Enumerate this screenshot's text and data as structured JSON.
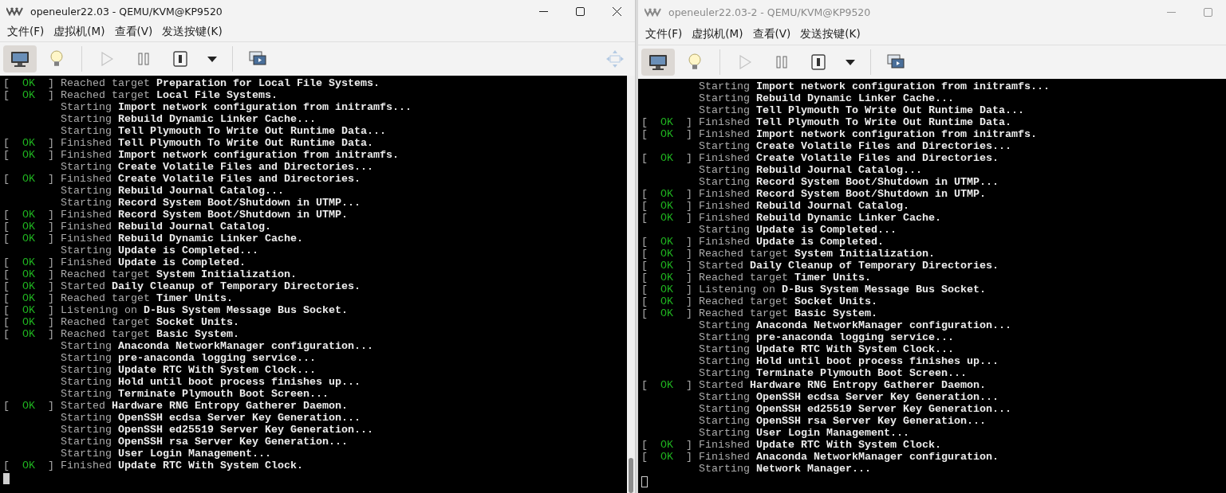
{
  "windows": [
    {
      "title": "openeuler22.03 - QEMU/KVM@KP9520",
      "active": true,
      "controls": [
        {
          "kind": "minimize"
        },
        {
          "kind": "maximize"
        },
        {
          "kind": "close"
        }
      ],
      "menu": [
        "文件(F)",
        "虚拟机(M)",
        "查看(V)",
        "发送按键(K)"
      ],
      "toolbar": [
        {
          "kind": "console",
          "selected": true,
          "disabled": false
        },
        {
          "kind": "details",
          "selected": false,
          "disabled": false
        },
        {
          "kind": "separator"
        },
        {
          "kind": "run",
          "selected": false,
          "disabled": true
        },
        {
          "kind": "pause",
          "selected": false,
          "disabled": false
        },
        {
          "kind": "shutdown",
          "selected": false,
          "disabled": false
        },
        {
          "kind": "caret",
          "selected": false,
          "disabled": false
        },
        {
          "kind": "separator"
        },
        {
          "kind": "screens",
          "selected": false,
          "disabled": false
        },
        {
          "kind": "resize",
          "selected": false,
          "disabled": true
        }
      ],
      "console": [
        {
          "status": "[  OK  ]",
          "verb": "Reached target",
          "target": "Preparation for Local File Systems."
        },
        {
          "status": "[  OK  ]",
          "verb": "Reached target",
          "target": "Local File Systems."
        },
        {
          "verb": "Starting",
          "target": "Import network configuration from initramfs..."
        },
        {
          "verb": "Starting",
          "target": "Rebuild Dynamic Linker Cache..."
        },
        {
          "verb": "Starting",
          "target": "Tell Plymouth To Write Out Runtime Data..."
        },
        {
          "status": "[  OK  ]",
          "verb": "Finished",
          "target": "Tell Plymouth To Write Out Runtime Data."
        },
        {
          "status": "[  OK  ]",
          "verb": "Finished",
          "target": "Import network configuration from initramfs."
        },
        {
          "verb": "Starting",
          "target": "Create Volatile Files and Directories..."
        },
        {
          "status": "[  OK  ]",
          "verb": "Finished",
          "target": "Create Volatile Files and Directories."
        },
        {
          "verb": "Starting",
          "target": "Rebuild Journal Catalog..."
        },
        {
          "verb": "Starting",
          "target": "Record System Boot/Shutdown in UTMP..."
        },
        {
          "status": "[  OK  ]",
          "verb": "Finished",
          "target": "Record System Boot/Shutdown in UTMP."
        },
        {
          "status": "[  OK  ]",
          "verb": "Finished",
          "target": "Rebuild Journal Catalog."
        },
        {
          "status": "[  OK  ]",
          "verb": "Finished",
          "target": "Rebuild Dynamic Linker Cache."
        },
        {
          "verb": "Starting",
          "target": "Update is Completed..."
        },
        {
          "status": "[  OK  ]",
          "verb": "Finished",
          "target": "Update is Completed."
        },
        {
          "status": "[  OK  ]",
          "verb": "Reached target",
          "target": "System Initialization."
        },
        {
          "status": "[  OK  ]",
          "verb": "Started",
          "target": "Daily Cleanup of Temporary Directories."
        },
        {
          "status": "[  OK  ]",
          "verb": "Reached target",
          "target": "Timer Units."
        },
        {
          "status": "[  OK  ]",
          "verb": "Listening on",
          "target": "D-Bus System Message Bus Socket."
        },
        {
          "status": "[  OK  ]",
          "verb": "Reached target",
          "target": "Socket Units."
        },
        {
          "status": "[  OK  ]",
          "verb": "Reached target",
          "target": "Basic System."
        },
        {
          "verb": "Starting",
          "target": "Anaconda NetworkManager configuration..."
        },
        {
          "verb": "Starting",
          "target": "pre-anaconda logging service..."
        },
        {
          "verb": "Starting",
          "target": "Update RTC With System Clock..."
        },
        {
          "verb": "Starting",
          "target": "Hold until boot process finishes up..."
        },
        {
          "verb": "Starting",
          "target": "Terminate Plymouth Boot Screen..."
        },
        {
          "status": "[  OK  ]",
          "verb": "Started",
          "target": "Hardware RNG Entropy Gatherer Daemon."
        },
        {
          "verb": "Starting",
          "target": "OpenSSH ecdsa Server Key Generation..."
        },
        {
          "verb": "Starting",
          "target": "OpenSSH ed25519 Server Key Generation..."
        },
        {
          "verb": "Starting",
          "target": "OpenSSH rsa Server Key Generation..."
        },
        {
          "verb": "Starting",
          "target": "User Login Management..."
        },
        {
          "status": "[  OK  ]",
          "verb": "Finished",
          "target": "Update RTC With System Clock."
        }
      ]
    },
    {
      "title": "openeuler22.03-2 - QEMU/KVM@KP9520",
      "active": false,
      "controls": [
        {
          "kind": "minimize"
        },
        {
          "kind": "maximize"
        }
      ],
      "menu": [
        "文件(F)",
        "虚拟机(M)",
        "查看(V)",
        "发送按键(K)"
      ],
      "toolbar": [
        {
          "kind": "console",
          "selected": true,
          "disabled": false
        },
        {
          "kind": "details",
          "selected": false,
          "disabled": false
        },
        {
          "kind": "separator"
        },
        {
          "kind": "run",
          "selected": false,
          "disabled": true
        },
        {
          "kind": "pause",
          "selected": false,
          "disabled": false
        },
        {
          "kind": "shutdown",
          "selected": false,
          "disabled": false
        },
        {
          "kind": "caret",
          "selected": false,
          "disabled": false
        },
        {
          "kind": "separator"
        },
        {
          "kind": "screens",
          "selected": false,
          "disabled": false
        }
      ],
      "console": [
        {
          "verb": "Starting",
          "target": "Import network configuration from initramfs..."
        },
        {
          "verb": "Starting",
          "target": "Rebuild Dynamic Linker Cache..."
        },
        {
          "verb": "Starting",
          "target": "Tell Plymouth To Write Out Runtime Data..."
        },
        {
          "status": "[  OK  ]",
          "verb": "Finished",
          "target": "Tell Plymouth To Write Out Runtime Data."
        },
        {
          "status": "[  OK  ]",
          "verb": "Finished",
          "target": "Import network configuration from initramfs."
        },
        {
          "verb": "Starting",
          "target": "Create Volatile Files and Directories..."
        },
        {
          "status": "[  OK  ]",
          "verb": "Finished",
          "target": "Create Volatile Files and Directories."
        },
        {
          "verb": "Starting",
          "target": "Rebuild Journal Catalog..."
        },
        {
          "verb": "Starting",
          "target": "Record System Boot/Shutdown in UTMP..."
        },
        {
          "status": "[  OK  ]",
          "verb": "Finished",
          "target": "Record System Boot/Shutdown in UTMP."
        },
        {
          "status": "[  OK  ]",
          "verb": "Finished",
          "target": "Rebuild Journal Catalog."
        },
        {
          "status": "[  OK  ]",
          "verb": "Finished",
          "target": "Rebuild Dynamic Linker Cache."
        },
        {
          "verb": "Starting",
          "target": "Update is Completed..."
        },
        {
          "status": "[  OK  ]",
          "verb": "Finished",
          "target": "Update is Completed."
        },
        {
          "status": "[  OK  ]",
          "verb": "Reached target",
          "target": "System Initialization."
        },
        {
          "status": "[  OK  ]",
          "verb": "Started",
          "target": "Daily Cleanup of Temporary Directories."
        },
        {
          "status": "[  OK  ]",
          "verb": "Reached target",
          "target": "Timer Units."
        },
        {
          "status": "[  OK  ]",
          "verb": "Listening on",
          "target": "D-Bus System Message Bus Socket."
        },
        {
          "status": "[  OK  ]",
          "verb": "Reached target",
          "target": "Socket Units."
        },
        {
          "status": "[  OK  ]",
          "verb": "Reached target",
          "target": "Basic System."
        },
        {
          "verb": "Starting",
          "target": "Anaconda NetworkManager configuration..."
        },
        {
          "verb": "Starting",
          "target": "pre-anaconda logging service..."
        },
        {
          "verb": "Starting",
          "target": "Update RTC With System Clock..."
        },
        {
          "verb": "Starting",
          "target": "Hold until boot process finishes up..."
        },
        {
          "verb": "Starting",
          "target": "Terminate Plymouth Boot Screen..."
        },
        {
          "status": "[  OK  ]",
          "verb": "Started",
          "target": "Hardware RNG Entropy Gatherer Daemon."
        },
        {
          "verb": "Starting",
          "target": "OpenSSH ecdsa Server Key Generation..."
        },
        {
          "verb": "Starting",
          "target": "OpenSSH ed25519 Server Key Generation..."
        },
        {
          "verb": "Starting",
          "target": "OpenSSH rsa Server Key Generation..."
        },
        {
          "verb": "Starting",
          "target": "User Login Management..."
        },
        {
          "status": "[  OK  ]",
          "verb": "Finished",
          "target": "Update RTC With System Clock."
        },
        {
          "status": "[  OK  ]",
          "verb": "Finished",
          "target": "Anaconda NetworkManager configuration."
        },
        {
          "verb": "Starting",
          "target": "Network Manager..."
        }
      ]
    }
  ]
}
